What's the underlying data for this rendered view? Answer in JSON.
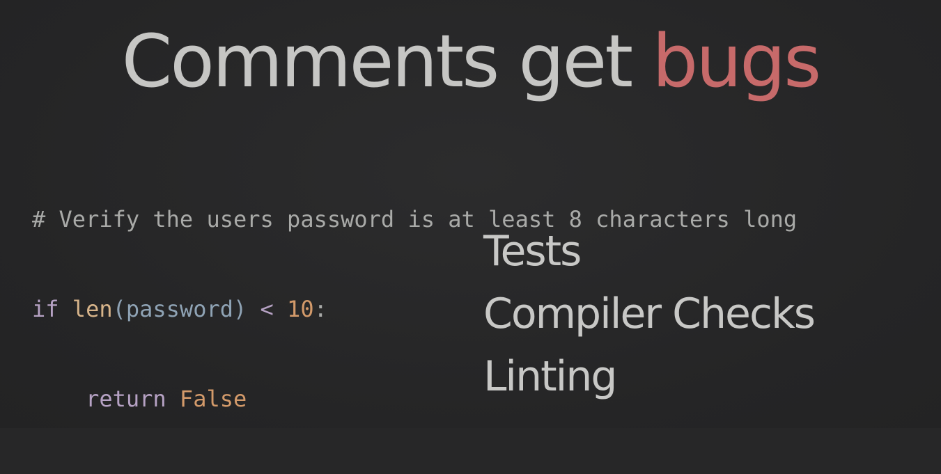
{
  "title": {
    "prefix": "Comments get ",
    "highlight": "bugs"
  },
  "code": {
    "comment": "# Verify the users password is at least 8 characters long",
    "line2": {
      "kw": "if",
      "fn": "len",
      "open": "(",
      "arg": "password",
      "close": ")",
      "op": "<",
      "num": "10",
      "colon": ":"
    },
    "line3": {
      "kw": "return",
      "value": "False"
    }
  },
  "list": {
    "items": [
      "Tests",
      "Compiler Checks",
      "Linting"
    ]
  },
  "colors": {
    "background": "#272728",
    "title": "#c6c6c4",
    "accent": "#c76a6a"
  }
}
